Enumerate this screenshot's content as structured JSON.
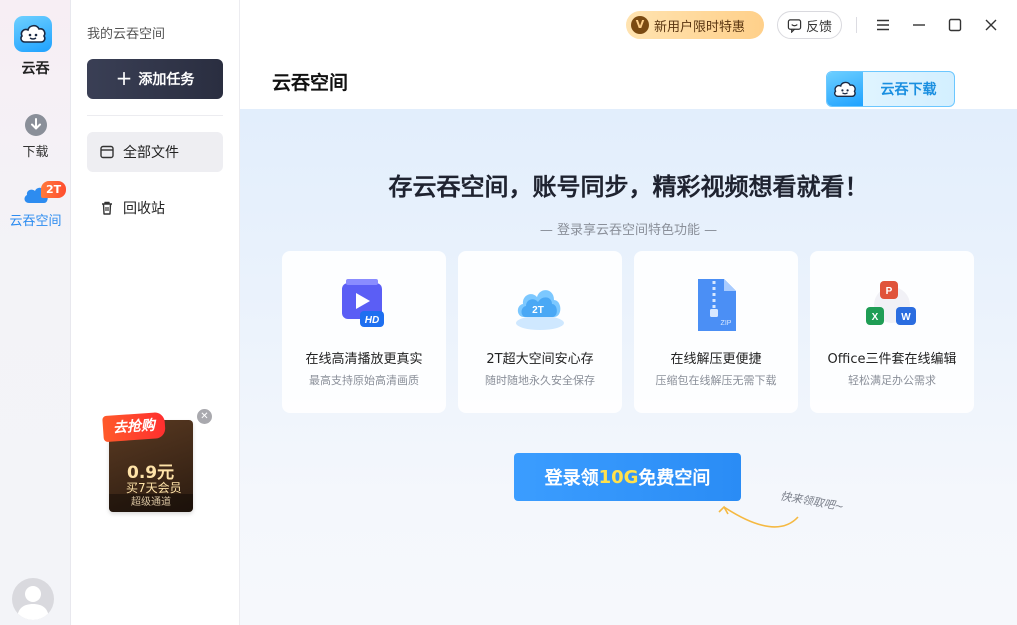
{
  "rail": {
    "app_name": "云吞",
    "download_label": "下载",
    "space_label": "云吞空间",
    "space_badge": "2T"
  },
  "sidebar": {
    "title": "我的云吞空间",
    "add_task": "添加任务",
    "nav_all": "全部文件",
    "nav_trash": "回收站"
  },
  "promo": {
    "tag": "去抢购",
    "price": "0.9元",
    "desc": "买7天会员",
    "footer": "超级通道"
  },
  "titlebar": {
    "vip_icon": "V",
    "vip_label": "新用户限时特惠",
    "feedback_label": "反馈"
  },
  "main": {
    "page_title": "云吞空间",
    "download_button": "云吞下载",
    "hero_title": "存云吞空间，账号同步，精彩视频想看就看！",
    "hero_subtitle": "— 登录享云吞空间特色功能 —",
    "features": [
      {
        "title": "在线高清播放更真实",
        "subtitle": "最高支持原始高清画质",
        "icon": "hd-video-icon"
      },
      {
        "title": "2T超大空间安心存",
        "subtitle": "随时随地永久安全保存",
        "icon": "cloud-2t-icon"
      },
      {
        "title": "在线解压更便捷",
        "subtitle": "压缩包在线解压无需下载",
        "icon": "zip-icon"
      },
      {
        "title": "Office三件套在线编辑",
        "subtitle": "轻松满足办公需求",
        "icon": "office-icon"
      }
    ],
    "login_prefix": "登录领",
    "login_highlight": "10G",
    "login_suffix": "免费空间",
    "hint": "快来领取吧~"
  },
  "colors": {
    "accent": "#2d8cf0",
    "login_button": "#3b9dff",
    "highlight": "#ffe14d",
    "vip_bg": "#ffd08a"
  }
}
